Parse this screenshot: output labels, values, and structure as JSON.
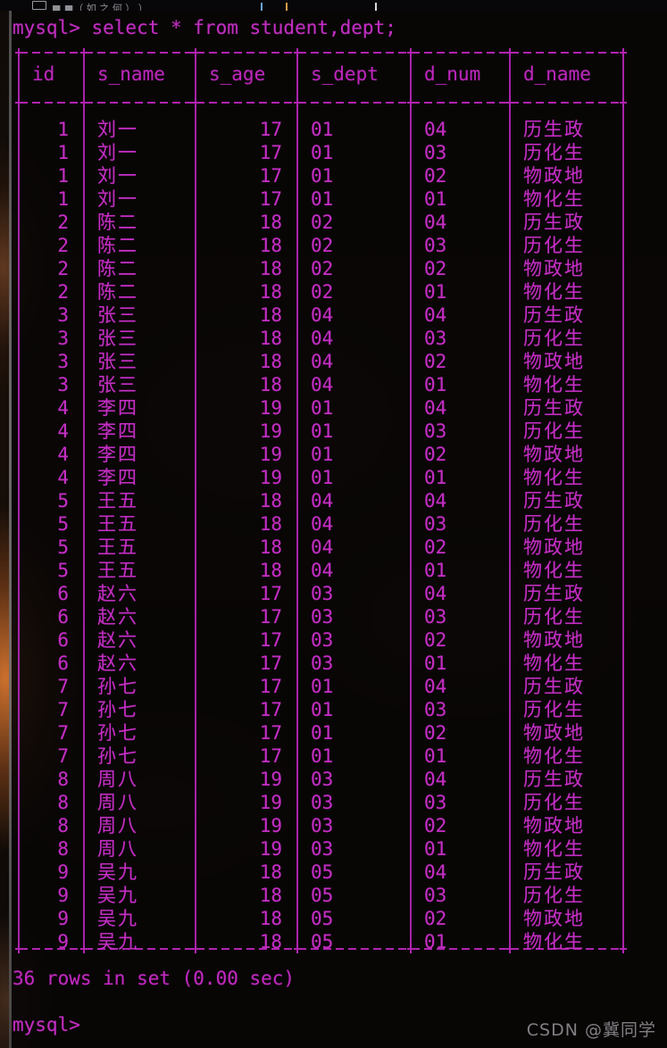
{
  "window": {
    "titlebar_fragment": "■ ■（ 如 之 何 ）     ）",
    "terminal_background": "#080505",
    "text_color": "#c32ec3",
    "border_color": "#b024b0"
  },
  "terminal": {
    "command_line": "mysql> select * from student,dept;",
    "prompt_symbol": "mysql>",
    "prompt_label": "mysql>",
    "separator": "+----+---------+-------+--------+-------+--------+",
    "status_line": "36 rows in set (0.00 sec)",
    "row_count": "36 rows",
    "elapsed": "(0.00 sec)"
  },
  "table": {
    "columns": [
      {
        "key": "id",
        "label": "id",
        "align": "right"
      },
      {
        "key": "s_name",
        "label": "s_name",
        "align": "left"
      },
      {
        "key": "s_age",
        "label": "s_age",
        "align": "right"
      },
      {
        "key": "s_dept",
        "label": "s_dept",
        "align": "left"
      },
      {
        "key": "d_num",
        "label": "d_num",
        "align": "left"
      },
      {
        "key": "d_name",
        "label": "d_name",
        "align": "left"
      }
    ],
    "rows": [
      [
        "1",
        "刘一",
        "17",
        "01",
        "04",
        "历生政"
      ],
      [
        "1",
        "刘一",
        "17",
        "01",
        "03",
        "历化生"
      ],
      [
        "1",
        "刘一",
        "17",
        "01",
        "02",
        "物政地"
      ],
      [
        "1",
        "刘一",
        "17",
        "01",
        "01",
        "物化生"
      ],
      [
        "2",
        "陈二",
        "18",
        "02",
        "04",
        "历生政"
      ],
      [
        "2",
        "陈二",
        "18",
        "02",
        "03",
        "历化生"
      ],
      [
        "2",
        "陈二",
        "18",
        "02",
        "02",
        "物政地"
      ],
      [
        "2",
        "陈二",
        "18",
        "02",
        "01",
        "物化生"
      ],
      [
        "3",
        "张三",
        "18",
        "04",
        "04",
        "历生政"
      ],
      [
        "3",
        "张三",
        "18",
        "04",
        "03",
        "历化生"
      ],
      [
        "3",
        "张三",
        "18",
        "04",
        "02",
        "物政地"
      ],
      [
        "3",
        "张三",
        "18",
        "04",
        "01",
        "物化生"
      ],
      [
        "4",
        "李四",
        "19",
        "01",
        "04",
        "历生政"
      ],
      [
        "4",
        "李四",
        "19",
        "01",
        "03",
        "历化生"
      ],
      [
        "4",
        "李四",
        "19",
        "01",
        "02",
        "物政地"
      ],
      [
        "4",
        "李四",
        "19",
        "01",
        "01",
        "物化生"
      ],
      [
        "5",
        "王五",
        "18",
        "04",
        "04",
        "历生政"
      ],
      [
        "5",
        "王五",
        "18",
        "04",
        "03",
        "历化生"
      ],
      [
        "5",
        "王五",
        "18",
        "04",
        "02",
        "物政地"
      ],
      [
        "5",
        "王五",
        "18",
        "04",
        "01",
        "物化生"
      ],
      [
        "6",
        "赵六",
        "17",
        "03",
        "04",
        "历生政"
      ],
      [
        "6",
        "赵六",
        "17",
        "03",
        "03",
        "历化生"
      ],
      [
        "6",
        "赵六",
        "17",
        "03",
        "02",
        "物政地"
      ],
      [
        "6",
        "赵六",
        "17",
        "03",
        "01",
        "物化生"
      ],
      [
        "7",
        "孙七",
        "17",
        "01",
        "04",
        "历生政"
      ],
      [
        "7",
        "孙七",
        "17",
        "01",
        "03",
        "历化生"
      ],
      [
        "7",
        "孙七",
        "17",
        "01",
        "02",
        "物政地"
      ],
      [
        "7",
        "孙七",
        "17",
        "01",
        "01",
        "物化生"
      ],
      [
        "8",
        "周八",
        "19",
        "03",
        "04",
        "历生政"
      ],
      [
        "8",
        "周八",
        "19",
        "03",
        "03",
        "历化生"
      ],
      [
        "8",
        "周八",
        "19",
        "03",
        "02",
        "物政地"
      ],
      [
        "8",
        "周八",
        "19",
        "03",
        "01",
        "物化生"
      ],
      [
        "9",
        "吴九",
        "18",
        "05",
        "04",
        "历生政"
      ],
      [
        "9",
        "吴九",
        "18",
        "05",
        "03",
        "历化生"
      ],
      [
        "9",
        "吴九",
        "18",
        "05",
        "02",
        "物政地"
      ],
      [
        "9",
        "吴九",
        "18",
        "05",
        "01",
        "物化生"
      ]
    ]
  },
  "watermark": {
    "text": "CSDN @冀同学"
  }
}
